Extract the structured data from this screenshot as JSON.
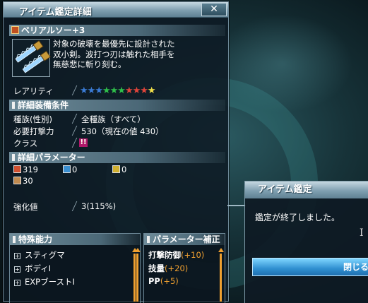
{
  "window": {
    "title": "アイテム鑑定詳細",
    "close_label": "✕"
  },
  "item": {
    "name": "ベリアルソー+3",
    "description": [
      "対象の破壊を最優先に設計された",
      "双小剣。波打つ刃は触れた相手を",
      "無慈悲に斬り刻む。"
    ]
  },
  "rarity": {
    "label": "レアリティ",
    "stars": 10,
    "star_colors": [
      "#3a7bd5",
      "#3a7bd5",
      "#3a7bd5",
      "#2fbf4a",
      "#2fbf4a",
      "#2fbf4a",
      "#e0443a",
      "#e0443a",
      "#e0443a",
      "#f2e04a"
    ]
  },
  "requirements": {
    "header": "詳細装備条件",
    "rows": [
      {
        "label": "種族(性別)",
        "value": "全種族（すべて）"
      },
      {
        "label": "必要打撃力",
        "value": "530（現在の値 430）"
      },
      {
        "label": "クラス",
        "value": ""
      }
    ],
    "class_icon": "double-exclaim-icon",
    "class_icon_color": "#b0186a"
  },
  "parameters": {
    "header": "詳細パラメーター",
    "items": [
      {
        "icon": "striking-attack-icon",
        "value": "319",
        "color": "#d05030"
      },
      {
        "icon": "ranged-attack-icon",
        "value": "0",
        "color": "#3a8fd0"
      },
      {
        "icon": "technique-attack-icon",
        "value": "0",
        "color": "#d0b030"
      },
      {
        "icon": "dex-icon",
        "value": "30",
        "color": "#c08a50"
      }
    ]
  },
  "enhance": {
    "label": "強化値",
    "value": "3(115%)"
  },
  "abilities": {
    "header": "特殊能力",
    "items": [
      "スティグマ",
      "ボディⅠ",
      "EXPブーストⅠ"
    ]
  },
  "bonuses": {
    "header": "パラメーター補正",
    "items": [
      {
        "label": "打撃防御",
        "amount": "(+10)"
      },
      {
        "label": "技量",
        "amount": "(+20)"
      },
      {
        "label": "PP",
        "amount": "(+5)"
      }
    ]
  },
  "dialog": {
    "title": "アイテム鑑定",
    "message": "鑑定が終了しました。",
    "button_label": "閉じる"
  },
  "colors": {
    "accent_orange": "#f0a030",
    "button_blue": "#2f8fd0"
  }
}
